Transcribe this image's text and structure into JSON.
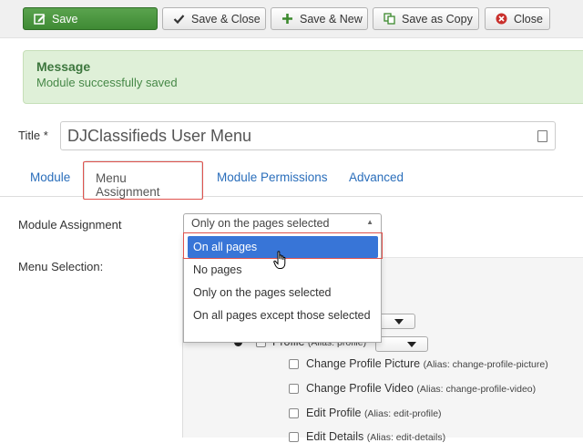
{
  "toolbar": {
    "save": "Save",
    "save_close": "Save & Close",
    "save_new": "Save & New",
    "save_copy": "Save as Copy",
    "close": "Close"
  },
  "message": {
    "heading": "Message",
    "body": "Module successfully saved"
  },
  "title": {
    "label": "Title *",
    "value": "DJClassifieds User Menu"
  },
  "tabs": [
    {
      "label": "Module"
    },
    {
      "label": "Menu Assignment"
    },
    {
      "label": "Module Permissions"
    },
    {
      "label": "Advanced"
    }
  ],
  "assignment": {
    "label": "Module Assignment",
    "selected": "Only on the pages selected",
    "options": [
      "On all pages",
      "No pages",
      "Only on the pages selected",
      "On all pages except those selected"
    ],
    "highlighted_option": "On all pages"
  },
  "menu_selection": {
    "label": "Menu Selection:",
    "items": [
      {
        "label": "Profile",
        "alias": "(Alias: profile)"
      },
      {
        "label": "Change Profile Picture",
        "alias": "(Alias: change-profile-picture)"
      },
      {
        "label": "Change Profile Video",
        "alias": "(Alias: change-profile-video)"
      },
      {
        "label": "Edit Profile",
        "alias": "(Alias: edit-profile)"
      },
      {
        "label": "Edit Details",
        "alias": "(Alias: edit-details)"
      }
    ]
  },
  "colors": {
    "save_button": "#3f8a34",
    "message_bg": "#dff0d8",
    "link": "#2a6ebb",
    "option_highlight": "#3875d7",
    "focus_outline": "#e0534e"
  }
}
